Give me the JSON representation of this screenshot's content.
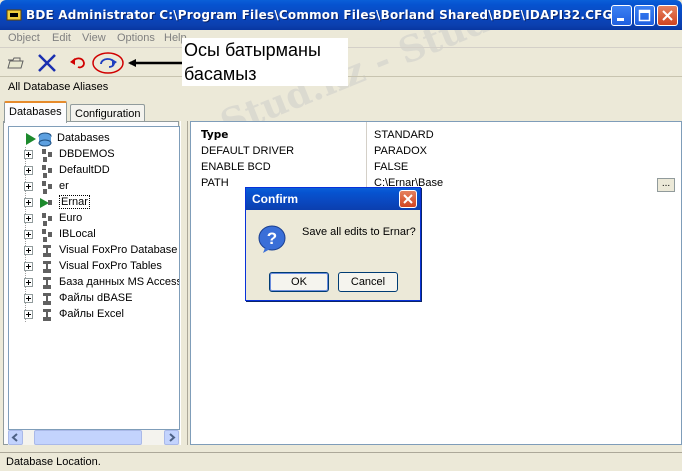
{
  "window": {
    "title": "BDE Administrator  C:\\Program Files\\Common Files\\Borland Shared\\BDE\\IDAPI32.CFG"
  },
  "menu": [
    "Object",
    "Edit",
    "View",
    "Options",
    "Help"
  ],
  "annotation": {
    "text": "Осы батырманы басамыз"
  },
  "aliases_label": "All Database Aliases",
  "tabs": [
    "Databases",
    "Configuration"
  ],
  "tree": {
    "root": "Databases",
    "items": [
      "DBDEMOS",
      "DefaultDD",
      "er",
      "Ernar",
      "Euro",
      "IBLocal",
      "Visual FoxPro Database",
      "Visual FoxPro Tables",
      "База данных MS Access",
      "Файлы dBASE",
      "Файлы Excel"
    ]
  },
  "properties": [
    {
      "name": "Type",
      "value": "STANDARD"
    },
    {
      "name": "DEFAULT DRIVER",
      "value": "PARADOX"
    },
    {
      "name": "ENABLE BCD",
      "value": "FALSE"
    },
    {
      "name": "PATH",
      "value": "C:\\Ernar\\Base"
    }
  ],
  "ellipsis": "...",
  "dialog": {
    "title": "Confirm",
    "message": "Save all edits to Ernar?",
    "ok": "OK",
    "cancel": "Cancel"
  },
  "status": "Database Location.",
  "watermark": "Stud.kz - Stud.kz",
  "icons": [
    "open-icon",
    "delete-icon",
    "undo-icon",
    "apply-icon",
    "question-icon"
  ],
  "colors": {
    "titlebar": "#0a48c0",
    "annotation_circle": "#d00000",
    "apply_icon": "#1f3fbf"
  }
}
